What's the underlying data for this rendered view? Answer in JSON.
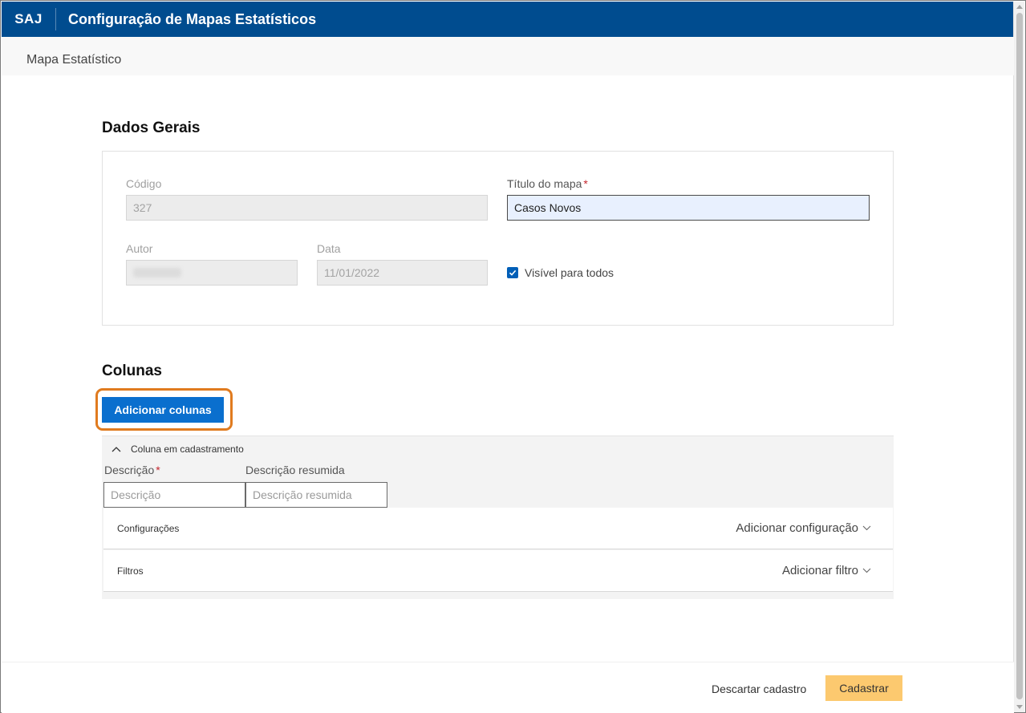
{
  "header": {
    "brand": "SAJ",
    "title": "Configuração de Mapas Estatísticos"
  },
  "subheader": {
    "title": "Mapa Estatístico"
  },
  "general": {
    "section_title": "Dados Gerais",
    "codigo_label": "Código",
    "codigo_value": "327",
    "titulo_label": "Título do mapa",
    "titulo_required": "*",
    "titulo_value": "Casos Novos",
    "autor_label": "Autor",
    "data_label": "Data",
    "data_value": "11/01/2022",
    "visivel_label": "Visível para todos",
    "visivel_checked": true
  },
  "columns": {
    "section_title": "Colunas",
    "add_button": "Adicionar colunas",
    "panel_title": "Coluna em cadastramento",
    "descricao_label": "Descrição",
    "descricao_required": "*",
    "descricao_placeholder": "Descrição",
    "resumida_label": "Descrição resumida",
    "resumida_placeholder": "Descrição resumida",
    "config_label": "Configurações",
    "config_action": "Adicionar configuração",
    "filtros_label": "Filtros",
    "filtros_action": "Adicionar filtro"
  },
  "footer": {
    "discard": "Descartar cadastro",
    "submit": "Cadastrar"
  },
  "colors": {
    "header_bg": "#004c8f",
    "primary_button": "#0a6fce",
    "highlight": "#e07b1f",
    "submit_button": "#fcc96f"
  }
}
